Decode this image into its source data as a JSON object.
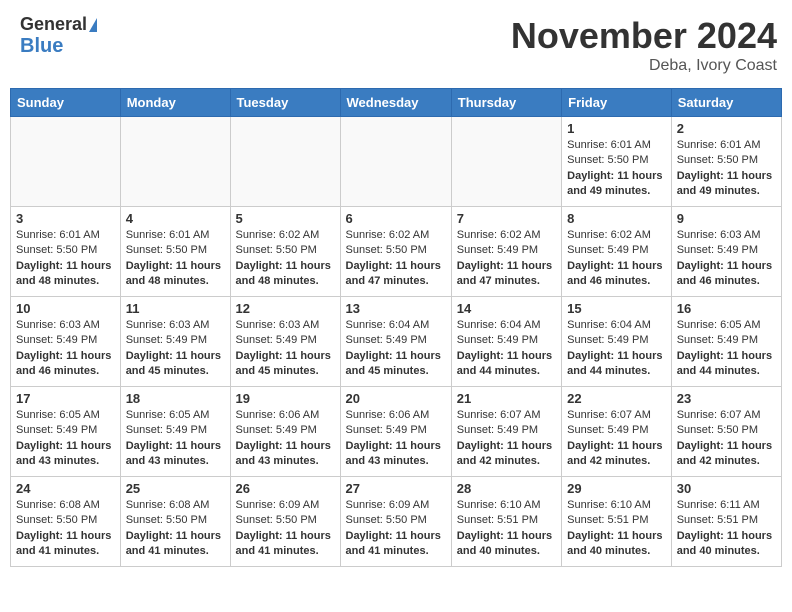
{
  "header": {
    "logo_line1": "General",
    "logo_line2": "Blue",
    "month": "November 2024",
    "location": "Deba, Ivory Coast"
  },
  "days_of_week": [
    "Sunday",
    "Monday",
    "Tuesday",
    "Wednesday",
    "Thursday",
    "Friday",
    "Saturday"
  ],
  "weeks": [
    [
      {
        "day": "",
        "info": ""
      },
      {
        "day": "",
        "info": ""
      },
      {
        "day": "",
        "info": ""
      },
      {
        "day": "",
        "info": ""
      },
      {
        "day": "",
        "info": ""
      },
      {
        "day": "1",
        "info": "Sunrise: 6:01 AM\nSunset: 5:50 PM\nDaylight: 11 hours and 49 minutes."
      },
      {
        "day": "2",
        "info": "Sunrise: 6:01 AM\nSunset: 5:50 PM\nDaylight: 11 hours and 49 minutes."
      }
    ],
    [
      {
        "day": "3",
        "info": "Sunrise: 6:01 AM\nSunset: 5:50 PM\nDaylight: 11 hours and 48 minutes."
      },
      {
        "day": "4",
        "info": "Sunrise: 6:01 AM\nSunset: 5:50 PM\nDaylight: 11 hours and 48 minutes."
      },
      {
        "day": "5",
        "info": "Sunrise: 6:02 AM\nSunset: 5:50 PM\nDaylight: 11 hours and 48 minutes."
      },
      {
        "day": "6",
        "info": "Sunrise: 6:02 AM\nSunset: 5:50 PM\nDaylight: 11 hours and 47 minutes."
      },
      {
        "day": "7",
        "info": "Sunrise: 6:02 AM\nSunset: 5:49 PM\nDaylight: 11 hours and 47 minutes."
      },
      {
        "day": "8",
        "info": "Sunrise: 6:02 AM\nSunset: 5:49 PM\nDaylight: 11 hours and 46 minutes."
      },
      {
        "day": "9",
        "info": "Sunrise: 6:03 AM\nSunset: 5:49 PM\nDaylight: 11 hours and 46 minutes."
      }
    ],
    [
      {
        "day": "10",
        "info": "Sunrise: 6:03 AM\nSunset: 5:49 PM\nDaylight: 11 hours and 46 minutes."
      },
      {
        "day": "11",
        "info": "Sunrise: 6:03 AM\nSunset: 5:49 PM\nDaylight: 11 hours and 45 minutes."
      },
      {
        "day": "12",
        "info": "Sunrise: 6:03 AM\nSunset: 5:49 PM\nDaylight: 11 hours and 45 minutes."
      },
      {
        "day": "13",
        "info": "Sunrise: 6:04 AM\nSunset: 5:49 PM\nDaylight: 11 hours and 45 minutes."
      },
      {
        "day": "14",
        "info": "Sunrise: 6:04 AM\nSunset: 5:49 PM\nDaylight: 11 hours and 44 minutes."
      },
      {
        "day": "15",
        "info": "Sunrise: 6:04 AM\nSunset: 5:49 PM\nDaylight: 11 hours and 44 minutes."
      },
      {
        "day": "16",
        "info": "Sunrise: 6:05 AM\nSunset: 5:49 PM\nDaylight: 11 hours and 44 minutes."
      }
    ],
    [
      {
        "day": "17",
        "info": "Sunrise: 6:05 AM\nSunset: 5:49 PM\nDaylight: 11 hours and 43 minutes."
      },
      {
        "day": "18",
        "info": "Sunrise: 6:05 AM\nSunset: 5:49 PM\nDaylight: 11 hours and 43 minutes."
      },
      {
        "day": "19",
        "info": "Sunrise: 6:06 AM\nSunset: 5:49 PM\nDaylight: 11 hours and 43 minutes."
      },
      {
        "day": "20",
        "info": "Sunrise: 6:06 AM\nSunset: 5:49 PM\nDaylight: 11 hours and 43 minutes."
      },
      {
        "day": "21",
        "info": "Sunrise: 6:07 AM\nSunset: 5:49 PM\nDaylight: 11 hours and 42 minutes."
      },
      {
        "day": "22",
        "info": "Sunrise: 6:07 AM\nSunset: 5:49 PM\nDaylight: 11 hours and 42 minutes."
      },
      {
        "day": "23",
        "info": "Sunrise: 6:07 AM\nSunset: 5:50 PM\nDaylight: 11 hours and 42 minutes."
      }
    ],
    [
      {
        "day": "24",
        "info": "Sunrise: 6:08 AM\nSunset: 5:50 PM\nDaylight: 11 hours and 41 minutes."
      },
      {
        "day": "25",
        "info": "Sunrise: 6:08 AM\nSunset: 5:50 PM\nDaylight: 11 hours and 41 minutes."
      },
      {
        "day": "26",
        "info": "Sunrise: 6:09 AM\nSunset: 5:50 PM\nDaylight: 11 hours and 41 minutes."
      },
      {
        "day": "27",
        "info": "Sunrise: 6:09 AM\nSunset: 5:50 PM\nDaylight: 11 hours and 41 minutes."
      },
      {
        "day": "28",
        "info": "Sunrise: 6:10 AM\nSunset: 5:51 PM\nDaylight: 11 hours and 40 minutes."
      },
      {
        "day": "29",
        "info": "Sunrise: 6:10 AM\nSunset: 5:51 PM\nDaylight: 11 hours and 40 minutes."
      },
      {
        "day": "30",
        "info": "Sunrise: 6:11 AM\nSunset: 5:51 PM\nDaylight: 11 hours and 40 minutes."
      }
    ]
  ]
}
